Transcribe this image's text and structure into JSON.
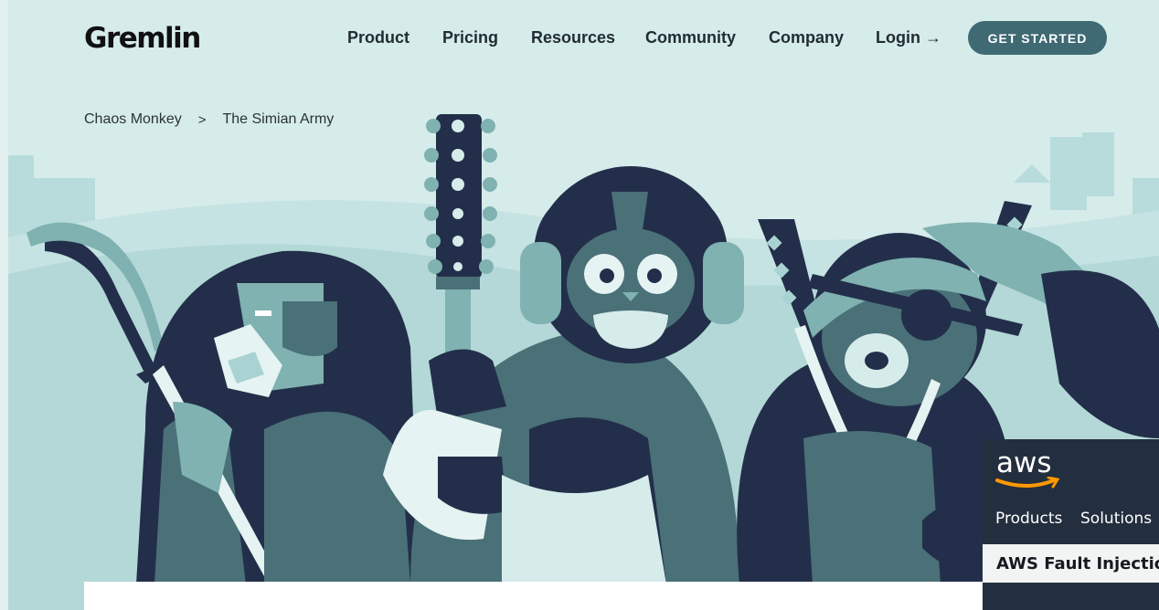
{
  "header": {
    "logo": "Gremlin",
    "nav": [
      "Product",
      "Pricing",
      "Resources",
      "Community",
      "Company"
    ],
    "login": "Login →",
    "cta": "GET STARTED"
  },
  "breadcrumb": {
    "items": [
      "Chaos Monkey",
      "The Simian Army"
    ],
    "separator": ">"
  },
  "aws_popup": {
    "logo": "aws",
    "nav": [
      "Products",
      "Solutions"
    ],
    "title": "AWS Fault Injection"
  },
  "colors": {
    "navy": "#232f4a",
    "teal": "#4a7078",
    "mint": "#a9d3d2",
    "cta": "#3f6a73",
    "aws_bg": "#232f3e",
    "aws_orange": "#ff9900"
  }
}
